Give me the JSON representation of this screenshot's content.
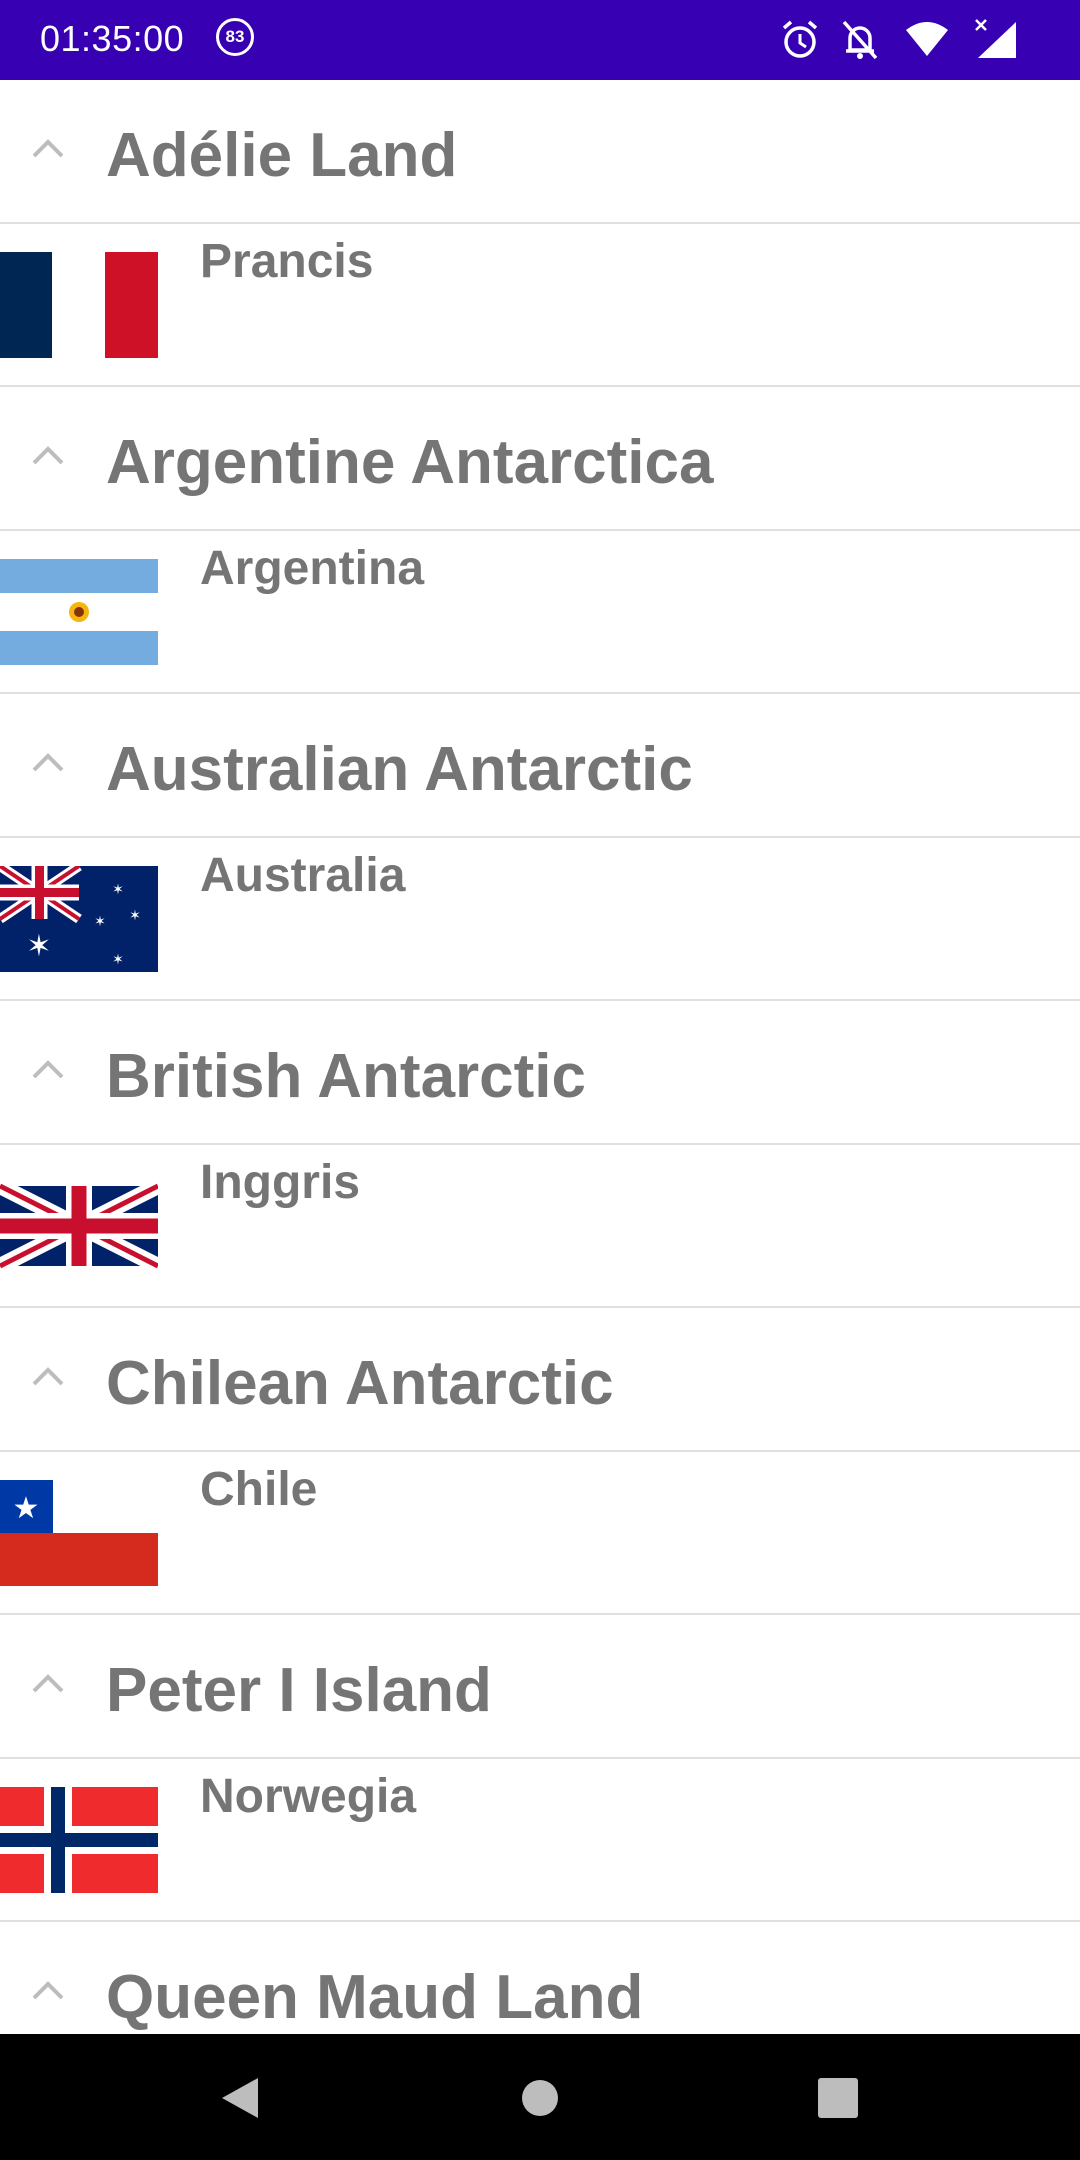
{
  "status_bar": {
    "time": "01:35:00",
    "notification_count": "83",
    "icons": [
      "alarm-icon",
      "notifications-off-icon",
      "wifi-icon",
      "signal-icon"
    ],
    "background": "#3700b3"
  },
  "groups": [
    {
      "title": "Adélie Land",
      "child": {
        "label": "Prancis",
        "flag_icon": "france-flag-icon"
      }
    },
    {
      "title": "Argentine Antarctica",
      "child": {
        "label": "Argentina",
        "flag_icon": "argentina-flag-icon"
      }
    },
    {
      "title": "Australian Antarctic",
      "child": {
        "label": "Australia",
        "flag_icon": "australia-flag-icon"
      }
    },
    {
      "title": "British Antarctic",
      "child": {
        "label": "Inggris",
        "flag_icon": "united-kingdom-flag-icon"
      }
    },
    {
      "title": "Chilean Antarctic",
      "child": {
        "label": "Chile",
        "flag_icon": "chile-flag-icon"
      }
    },
    {
      "title": "Peter I Island",
      "child": {
        "label": "Norwegia",
        "flag_icon": "norway-flag-icon"
      }
    },
    {
      "title": "Queen Maud Land"
    }
  ],
  "nav_bar": {
    "buttons": [
      "back-icon",
      "home-icon",
      "recents-icon"
    ]
  },
  "colors": {
    "text": "#757575",
    "divider": "#e0e0e0",
    "chevron": "#bdbdbd"
  }
}
